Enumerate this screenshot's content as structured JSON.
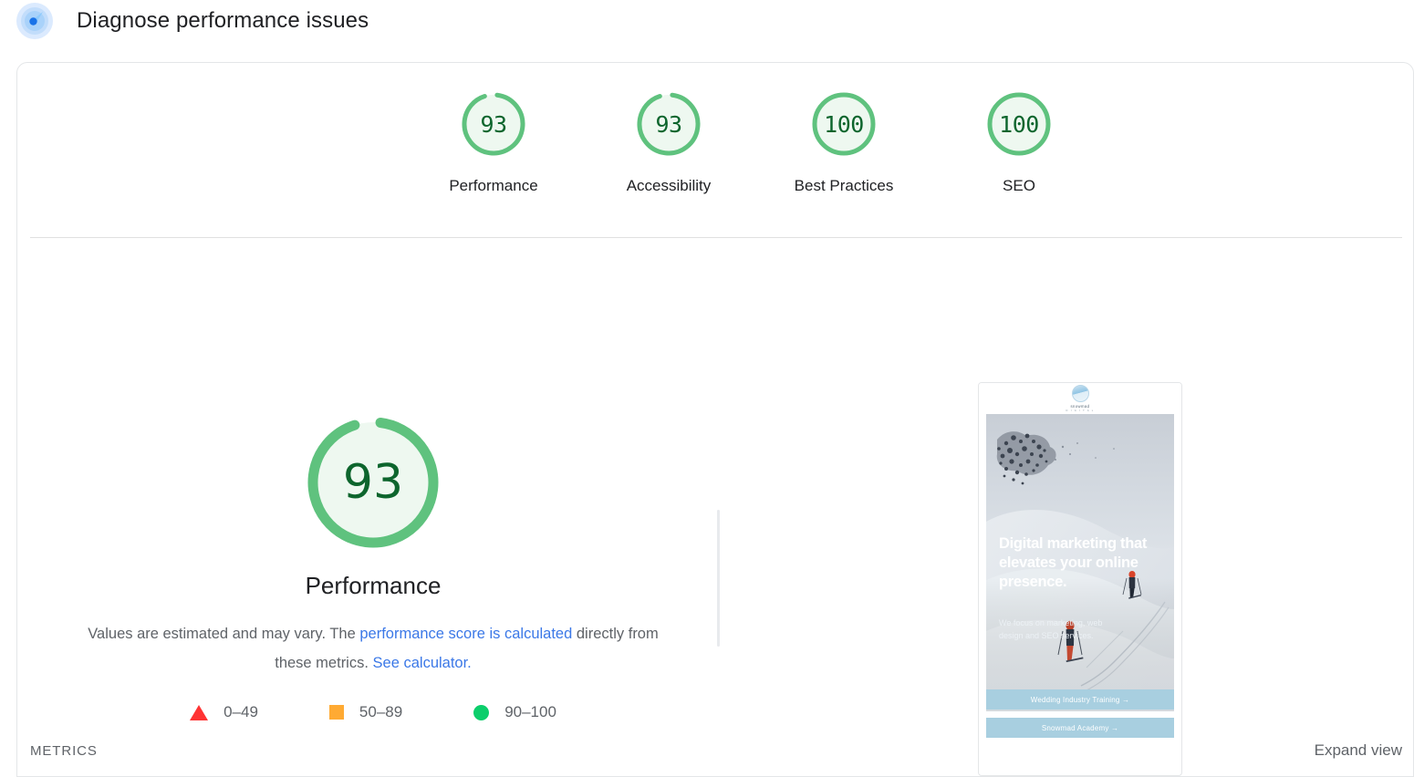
{
  "header": {
    "title": "Diagnose performance issues",
    "icon": "lighthouse-icon"
  },
  "category_scores": [
    {
      "value": "93",
      "label": "Performance",
      "pct": 93,
      "state": "pass"
    },
    {
      "value": "93",
      "label": "Accessibility",
      "pct": 93,
      "state": "pass"
    },
    {
      "value": "100",
      "label": "Best Practices",
      "pct": 100,
      "state": "pass"
    },
    {
      "value": "100",
      "label": "SEO",
      "pct": 100,
      "state": "pass"
    }
  ],
  "main_score": {
    "value": "93",
    "title": "Performance",
    "pct": 93,
    "description_prefix": "Values are estimated and may vary. The ",
    "link_text": "performance score is calculated",
    "description_middle": " directly from these metrics. ",
    "calculator_link": "See calculator.",
    "full_description": "Values are estimated and may vary. The performance score is calculated directly from these metrics. See calculator."
  },
  "legend": [
    {
      "icon": "triangle-fail-icon",
      "label": "0–49",
      "color": "#ff3333"
    },
    {
      "icon": "square-average-icon",
      "label": "50–89",
      "color": "#ffaa33"
    },
    {
      "icon": "circle-pass-icon",
      "label": "90–100",
      "color": "#0cce6b"
    }
  ],
  "screenshot_preview": {
    "site_logo_text": "snowmad",
    "site_logo_sub": "D I G I T A L",
    "headline": "Digital marketing that elevates your online presence.",
    "subhead": "We focus on marketing, web design and SEO services.",
    "buttons": [
      "Wedding Industry Training →",
      "Snowmad Academy →"
    ]
  },
  "footer": {
    "metrics_label": "METRICS",
    "expand_view_label": "Expand view"
  },
  "colors": {
    "pass_green": "#0cce6b",
    "ring_green": "#5fc27e",
    "ring_fill": "#eef8f0",
    "score_text": "#0d652d",
    "link_blue": "#3b78e7",
    "average_orange": "#ffaa33",
    "fail_red": "#ff3333"
  }
}
